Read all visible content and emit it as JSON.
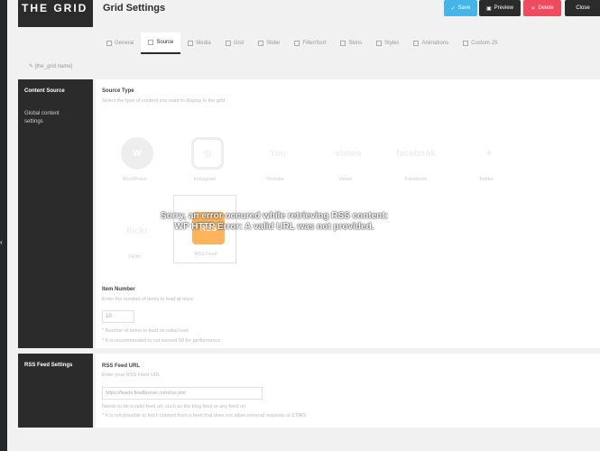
{
  "brand": {
    "logo_text": "THE GRID"
  },
  "page": {
    "title": "Grid Settings"
  },
  "actions": {
    "save": "Save",
    "preview": "Preview",
    "delete": "Delete",
    "close": "Close"
  },
  "tabs": [
    {
      "label": "General",
      "icon": "gear-icon"
    },
    {
      "label": "Source",
      "icon": "source-icon",
      "active": true
    },
    {
      "label": "Media",
      "icon": "media-icon"
    },
    {
      "label": "Grid",
      "icon": "grid-icon"
    },
    {
      "label": "Slider",
      "icon": "slider-icon"
    },
    {
      "label": "Filter/Sort",
      "icon": "filter-icon"
    },
    {
      "label": "Skins",
      "icon": "skins-icon"
    },
    {
      "label": "Styles",
      "icon": "styles-icon"
    },
    {
      "label": "Animations",
      "icon": "animation-icon"
    },
    {
      "label": "Custom JS",
      "icon": "code-icon"
    }
  ],
  "shortcode": {
    "icon": "pencil-icon",
    "text": "[the_grid name]"
  },
  "sidebar": {
    "section1_title": "Content Source",
    "section1_item": "Global content settings",
    "section2_title": "RSS Feed Settings"
  },
  "content_source": {
    "label": "Source Type",
    "desc": "Select the type of content you want to display in the grid",
    "sources": [
      {
        "name": "WordPress",
        "icon": "wordpress-icon",
        "glyph": "W"
      },
      {
        "name": "Instagram",
        "icon": "instagram-icon",
        "glyph": "◎"
      },
      {
        "name": "Youtube",
        "icon": "youtube-icon",
        "glyph": "You"
      },
      {
        "name": "Vimeo",
        "icon": "vimeo-icon",
        "glyph": "vimeo"
      },
      {
        "name": "Facebook",
        "icon": "facebook-icon",
        "glyph": "facebook"
      },
      {
        "name": "Twitter",
        "icon": "twitter-icon",
        "glyph": "✦"
      },
      {
        "name": "Flickr",
        "icon": "flickr-icon",
        "glyph": "flickr"
      },
      {
        "name": "RSS Feed",
        "icon": "rss-icon",
        "glyph": "RSS",
        "selected": true
      }
    ]
  },
  "item_number": {
    "label": "Item Number",
    "desc": "Enter the number of items to load at once",
    "value": "10",
    "note1": "* Number of items to load on initial load",
    "note2": "* It is recommended to not exceed 50 for performance"
  },
  "rss": {
    "label": "RSS Feed URL",
    "desc": "Enter your RSS Feed URL",
    "url": "https://feeds.feedburner.com/rss.xml",
    "help1": "Needs to be a valid feed url, such as the blog feed or any feed url",
    "help2": "* It is not possible to fetch content from a feed that does not allow external requests or CORS"
  },
  "error": {
    "line1": "Sorry, an error occured while retrieving RSS content:",
    "line2": "WP HTTP Error: A valid URL was not provided."
  },
  "colors": {
    "dark": "#2b2b2b",
    "save": "#43b5e8",
    "delete": "#ef4a5e",
    "rss": "#ffb35a"
  }
}
